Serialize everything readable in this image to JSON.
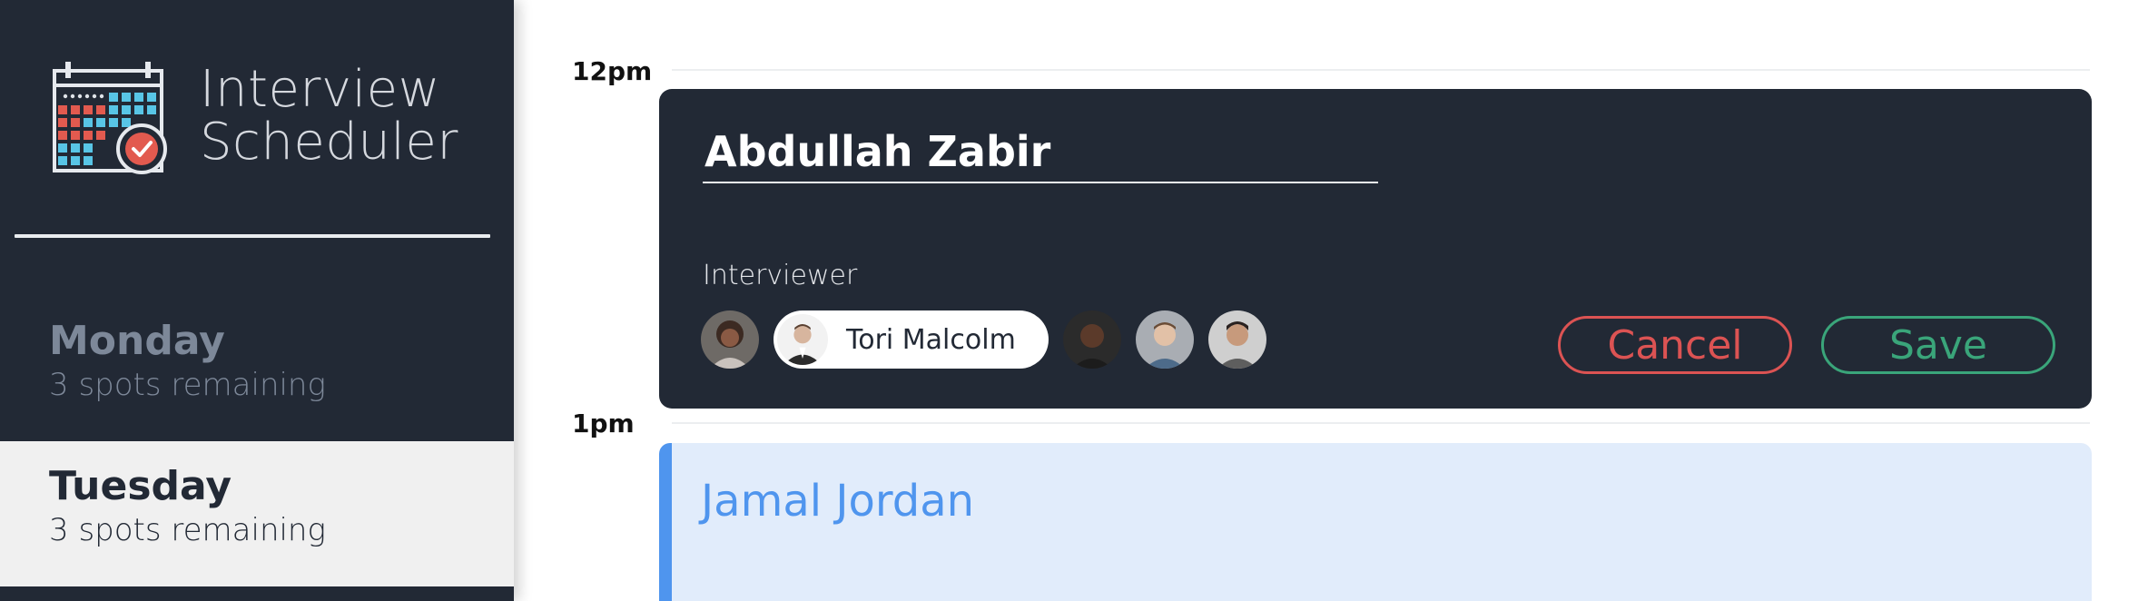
{
  "app": {
    "title_line1": "Interview",
    "title_line2": "Scheduler",
    "logo_icon": "calendar-check-icon"
  },
  "days": [
    {
      "name": "Monday",
      "spots": "3 spots remaining",
      "selected": false
    },
    {
      "name": "Tuesday",
      "spots": "3 spots remaining",
      "selected": true
    }
  ],
  "schedule": {
    "times": [
      "12pm",
      "1pm"
    ],
    "edit_form": {
      "student_name_value": "Abdullah Zabir",
      "interviewer_heading": "Interviewer",
      "selected_interviewer": "Tori Malcolm",
      "interviewer_avatars": [
        "avatar-1",
        "avatar-2-selected",
        "avatar-3",
        "avatar-4",
        "avatar-5"
      ],
      "cancel_label": "Cancel",
      "save_label": "Save"
    },
    "appointment": {
      "student": "Jamal Jordan"
    }
  },
  "colors": {
    "dark": "#222935",
    "cancel": "#dc5353",
    "save": "#3aa57a",
    "appointment_accent": "#4f95ee",
    "appointment_bg": "#e1ecfb"
  }
}
